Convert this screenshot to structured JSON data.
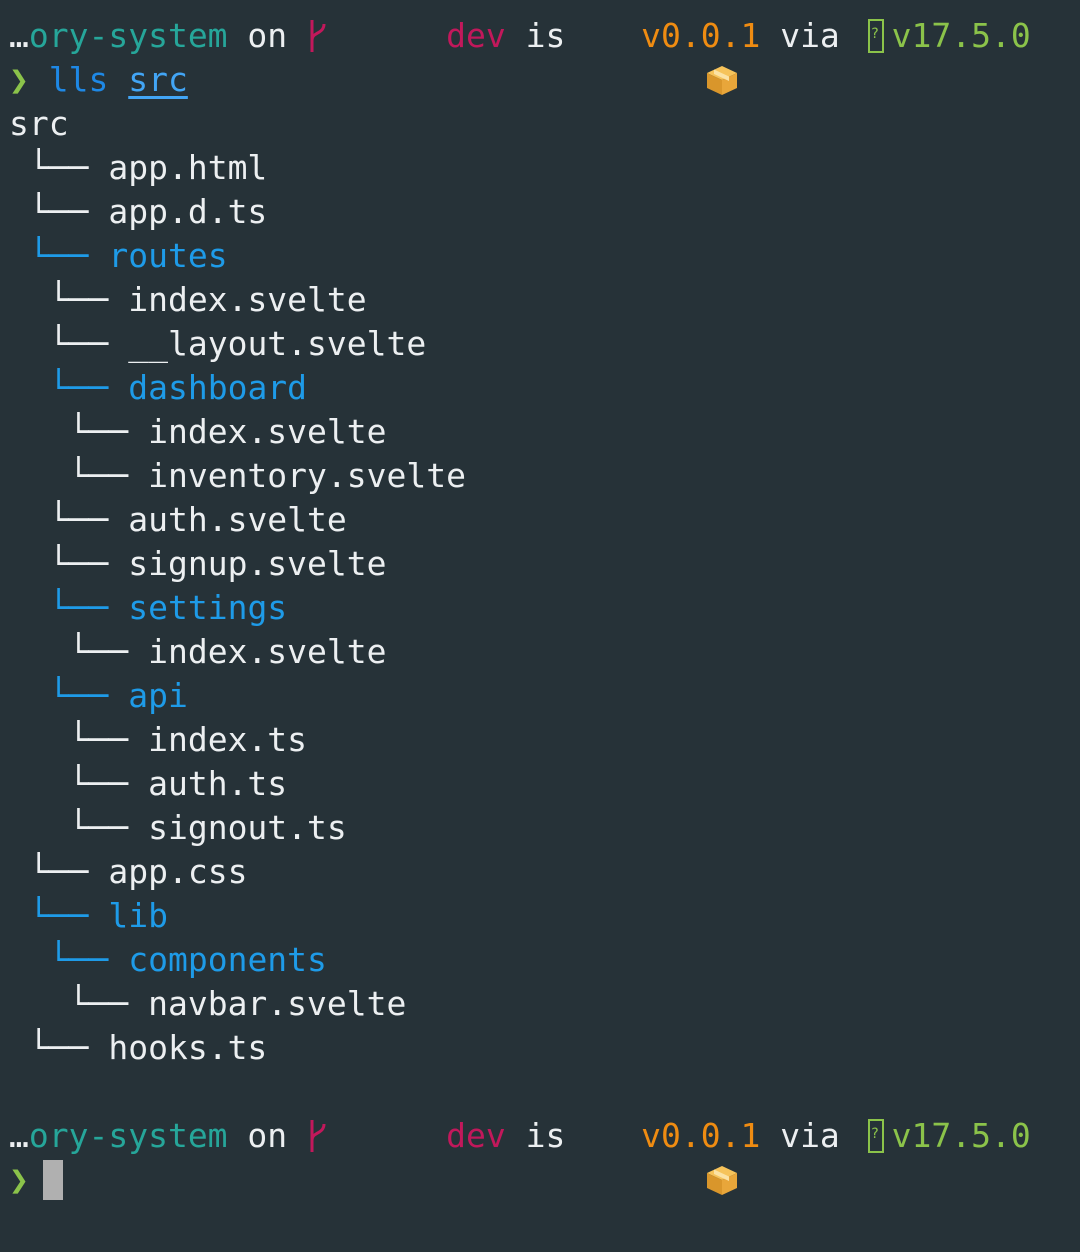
{
  "prompt": {
    "dir_ellipsis": "…",
    "dir": "ory-system",
    "on": " on ",
    "branch": "dev",
    "is": " is ",
    "pkg_version": "v0.0.1",
    "via": " via ",
    "node_version": "v17.5.0",
    "arrow": "❯"
  },
  "command": {
    "name": "lls",
    "arg": "src"
  },
  "tree": {
    "root": "src",
    "entries": [
      {
        "depth": 1,
        "name": "app.html",
        "folder": false
      },
      {
        "depth": 1,
        "name": "app.d.ts",
        "folder": false
      },
      {
        "depth": 1,
        "name": "routes",
        "folder": true
      },
      {
        "depth": 2,
        "name": "index.svelte",
        "folder": false
      },
      {
        "depth": 2,
        "name": "__layout.svelte",
        "folder": false
      },
      {
        "depth": 2,
        "name": "dashboard",
        "folder": true
      },
      {
        "depth": 3,
        "name": "index.svelte",
        "folder": false
      },
      {
        "depth": 3,
        "name": "inventory.svelte",
        "folder": false
      },
      {
        "depth": 2,
        "name": "auth.svelte",
        "folder": false
      },
      {
        "depth": 2,
        "name": "signup.svelte",
        "folder": false
      },
      {
        "depth": 2,
        "name": "settings",
        "folder": true
      },
      {
        "depth": 3,
        "name": "index.svelte",
        "folder": false
      },
      {
        "depth": 2,
        "name": "api",
        "folder": true
      },
      {
        "depth": 3,
        "name": "index.ts",
        "folder": false
      },
      {
        "depth": 3,
        "name": "auth.ts",
        "folder": false
      },
      {
        "depth": 3,
        "name": "signout.ts",
        "folder": false
      },
      {
        "depth": 1,
        "name": "app.css",
        "folder": false
      },
      {
        "depth": 1,
        "name": "lib",
        "folder": true
      },
      {
        "depth": 2,
        "name": "components",
        "folder": true
      },
      {
        "depth": 3,
        "name": "navbar.svelte",
        "folder": false
      },
      {
        "depth": 1,
        "name": "hooks.ts",
        "folder": false
      }
    ],
    "branch_glyph": "└──"
  },
  "colors": {
    "background": "#263238",
    "directory": "#26a69a",
    "git_branch": "#c2185b",
    "package": "#ef8c12",
    "node": "#8bc34a",
    "folder": "#1e9be8"
  },
  "icons": {
    "branch": "git-branch-icon",
    "package": "package-box-icon",
    "node": "nodejs-icon",
    "cursor": "terminal-cursor"
  }
}
